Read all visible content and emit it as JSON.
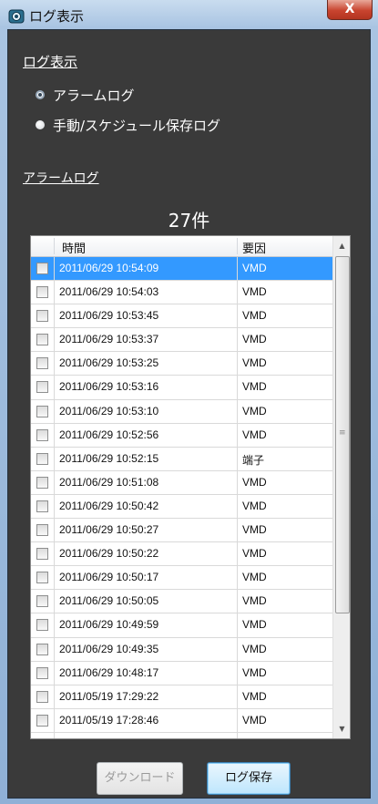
{
  "window": {
    "title": "ログ表示",
    "close_glyph": "X"
  },
  "log_section": {
    "heading": "ログ表示",
    "options": [
      {
        "label": "アラームログ",
        "selected": true
      },
      {
        "label": "手動/スケジュール保存ログ",
        "selected": false
      }
    ]
  },
  "alarm_log": {
    "heading": "アラームログ",
    "count": "27件",
    "columns": [
      "時間",
      "要因"
    ],
    "rows": [
      {
        "time": "2011/06/29 10:54:09",
        "cause": "VMD",
        "selected": true
      },
      {
        "time": "2011/06/29 10:54:03",
        "cause": "VMD"
      },
      {
        "time": "2011/06/29 10:53:45",
        "cause": "VMD"
      },
      {
        "time": "2011/06/29 10:53:37",
        "cause": "VMD"
      },
      {
        "time": "2011/06/29 10:53:25",
        "cause": "VMD"
      },
      {
        "time": "2011/06/29 10:53:16",
        "cause": "VMD"
      },
      {
        "time": "2011/06/29 10:53:10",
        "cause": "VMD"
      },
      {
        "time": "2011/06/29 10:52:56",
        "cause": "VMD"
      },
      {
        "time": "2011/06/29 10:52:15",
        "cause": "端子"
      },
      {
        "time": "2011/06/29 10:51:08",
        "cause": "VMD"
      },
      {
        "time": "2011/06/29 10:50:42",
        "cause": "VMD"
      },
      {
        "time": "2011/06/29 10:50:27",
        "cause": "VMD"
      },
      {
        "time": "2011/06/29 10:50:22",
        "cause": "VMD"
      },
      {
        "time": "2011/06/29 10:50:17",
        "cause": "VMD"
      },
      {
        "time": "2011/06/29 10:50:05",
        "cause": "VMD"
      },
      {
        "time": "2011/06/29 10:49:59",
        "cause": "VMD"
      },
      {
        "time": "2011/06/29 10:49:35",
        "cause": "VMD"
      },
      {
        "time": "2011/06/29 10:48:17",
        "cause": "VMD"
      },
      {
        "time": "2011/05/19 17:29:22",
        "cause": "VMD"
      },
      {
        "time": "2011/05/19 17:28:46",
        "cause": "VMD"
      }
    ]
  },
  "buttons": {
    "download": "ダウンロード",
    "save": "ログ保存"
  },
  "colors": {
    "selection": "#3399ff",
    "panel": "#3a3a3a",
    "close_button": "#c8442f"
  }
}
